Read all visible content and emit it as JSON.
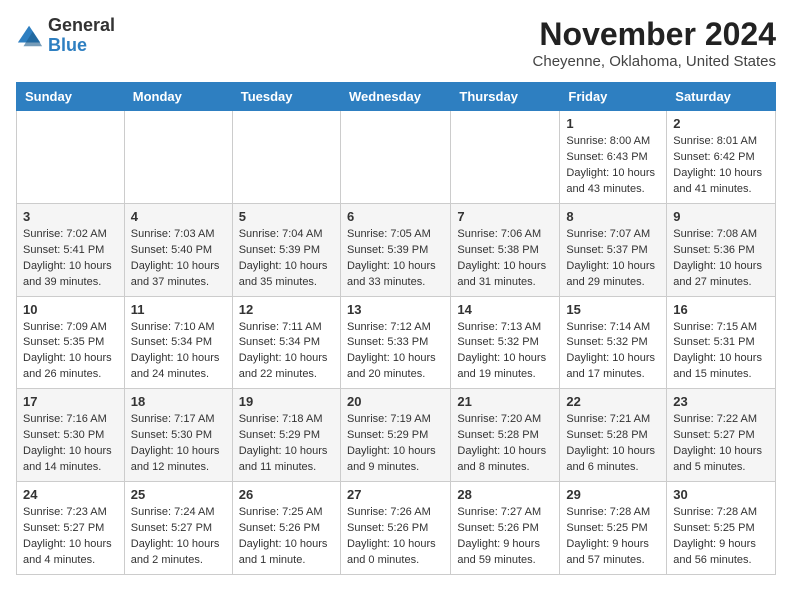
{
  "logo": {
    "general": "General",
    "blue": "Blue"
  },
  "header": {
    "month": "November 2024",
    "location": "Cheyenne, Oklahoma, United States"
  },
  "weekdays": [
    "Sunday",
    "Monday",
    "Tuesday",
    "Wednesday",
    "Thursday",
    "Friday",
    "Saturday"
  ],
  "weeks": [
    [
      {
        "day": "",
        "sunrise": "",
        "sunset": "",
        "daylight": ""
      },
      {
        "day": "",
        "sunrise": "",
        "sunset": "",
        "daylight": ""
      },
      {
        "day": "",
        "sunrise": "",
        "sunset": "",
        "daylight": ""
      },
      {
        "day": "",
        "sunrise": "",
        "sunset": "",
        "daylight": ""
      },
      {
        "day": "",
        "sunrise": "",
        "sunset": "",
        "daylight": ""
      },
      {
        "day": "1",
        "sunrise": "Sunrise: 8:00 AM",
        "sunset": "Sunset: 6:43 PM",
        "daylight": "Daylight: 10 hours and 43 minutes."
      },
      {
        "day": "2",
        "sunrise": "Sunrise: 8:01 AM",
        "sunset": "Sunset: 6:42 PM",
        "daylight": "Daylight: 10 hours and 41 minutes."
      }
    ],
    [
      {
        "day": "3",
        "sunrise": "Sunrise: 7:02 AM",
        "sunset": "Sunset: 5:41 PM",
        "daylight": "Daylight: 10 hours and 39 minutes."
      },
      {
        "day": "4",
        "sunrise": "Sunrise: 7:03 AM",
        "sunset": "Sunset: 5:40 PM",
        "daylight": "Daylight: 10 hours and 37 minutes."
      },
      {
        "day": "5",
        "sunrise": "Sunrise: 7:04 AM",
        "sunset": "Sunset: 5:39 PM",
        "daylight": "Daylight: 10 hours and 35 minutes."
      },
      {
        "day": "6",
        "sunrise": "Sunrise: 7:05 AM",
        "sunset": "Sunset: 5:39 PM",
        "daylight": "Daylight: 10 hours and 33 minutes."
      },
      {
        "day": "7",
        "sunrise": "Sunrise: 7:06 AM",
        "sunset": "Sunset: 5:38 PM",
        "daylight": "Daylight: 10 hours and 31 minutes."
      },
      {
        "day": "8",
        "sunrise": "Sunrise: 7:07 AM",
        "sunset": "Sunset: 5:37 PM",
        "daylight": "Daylight: 10 hours and 29 minutes."
      },
      {
        "day": "9",
        "sunrise": "Sunrise: 7:08 AM",
        "sunset": "Sunset: 5:36 PM",
        "daylight": "Daylight: 10 hours and 27 minutes."
      }
    ],
    [
      {
        "day": "10",
        "sunrise": "Sunrise: 7:09 AM",
        "sunset": "Sunset: 5:35 PM",
        "daylight": "Daylight: 10 hours and 26 minutes."
      },
      {
        "day": "11",
        "sunrise": "Sunrise: 7:10 AM",
        "sunset": "Sunset: 5:34 PM",
        "daylight": "Daylight: 10 hours and 24 minutes."
      },
      {
        "day": "12",
        "sunrise": "Sunrise: 7:11 AM",
        "sunset": "Sunset: 5:34 PM",
        "daylight": "Daylight: 10 hours and 22 minutes."
      },
      {
        "day": "13",
        "sunrise": "Sunrise: 7:12 AM",
        "sunset": "Sunset: 5:33 PM",
        "daylight": "Daylight: 10 hours and 20 minutes."
      },
      {
        "day": "14",
        "sunrise": "Sunrise: 7:13 AM",
        "sunset": "Sunset: 5:32 PM",
        "daylight": "Daylight: 10 hours and 19 minutes."
      },
      {
        "day": "15",
        "sunrise": "Sunrise: 7:14 AM",
        "sunset": "Sunset: 5:32 PM",
        "daylight": "Daylight: 10 hours and 17 minutes."
      },
      {
        "day": "16",
        "sunrise": "Sunrise: 7:15 AM",
        "sunset": "Sunset: 5:31 PM",
        "daylight": "Daylight: 10 hours and 15 minutes."
      }
    ],
    [
      {
        "day": "17",
        "sunrise": "Sunrise: 7:16 AM",
        "sunset": "Sunset: 5:30 PM",
        "daylight": "Daylight: 10 hours and 14 minutes."
      },
      {
        "day": "18",
        "sunrise": "Sunrise: 7:17 AM",
        "sunset": "Sunset: 5:30 PM",
        "daylight": "Daylight: 10 hours and 12 minutes."
      },
      {
        "day": "19",
        "sunrise": "Sunrise: 7:18 AM",
        "sunset": "Sunset: 5:29 PM",
        "daylight": "Daylight: 10 hours and 11 minutes."
      },
      {
        "day": "20",
        "sunrise": "Sunrise: 7:19 AM",
        "sunset": "Sunset: 5:29 PM",
        "daylight": "Daylight: 10 hours and 9 minutes."
      },
      {
        "day": "21",
        "sunrise": "Sunrise: 7:20 AM",
        "sunset": "Sunset: 5:28 PM",
        "daylight": "Daylight: 10 hours and 8 minutes."
      },
      {
        "day": "22",
        "sunrise": "Sunrise: 7:21 AM",
        "sunset": "Sunset: 5:28 PM",
        "daylight": "Daylight: 10 hours and 6 minutes."
      },
      {
        "day": "23",
        "sunrise": "Sunrise: 7:22 AM",
        "sunset": "Sunset: 5:27 PM",
        "daylight": "Daylight: 10 hours and 5 minutes."
      }
    ],
    [
      {
        "day": "24",
        "sunrise": "Sunrise: 7:23 AM",
        "sunset": "Sunset: 5:27 PM",
        "daylight": "Daylight: 10 hours and 4 minutes."
      },
      {
        "day": "25",
        "sunrise": "Sunrise: 7:24 AM",
        "sunset": "Sunset: 5:27 PM",
        "daylight": "Daylight: 10 hours and 2 minutes."
      },
      {
        "day": "26",
        "sunrise": "Sunrise: 7:25 AM",
        "sunset": "Sunset: 5:26 PM",
        "daylight": "Daylight: 10 hours and 1 minute."
      },
      {
        "day": "27",
        "sunrise": "Sunrise: 7:26 AM",
        "sunset": "Sunset: 5:26 PM",
        "daylight": "Daylight: 10 hours and 0 minutes."
      },
      {
        "day": "28",
        "sunrise": "Sunrise: 7:27 AM",
        "sunset": "Sunset: 5:26 PM",
        "daylight": "Daylight: 9 hours and 59 minutes."
      },
      {
        "day": "29",
        "sunrise": "Sunrise: 7:28 AM",
        "sunset": "Sunset: 5:25 PM",
        "daylight": "Daylight: 9 hours and 57 minutes."
      },
      {
        "day": "30",
        "sunrise": "Sunrise: 7:28 AM",
        "sunset": "Sunset: 5:25 PM",
        "daylight": "Daylight: 9 hours and 56 minutes."
      }
    ]
  ]
}
